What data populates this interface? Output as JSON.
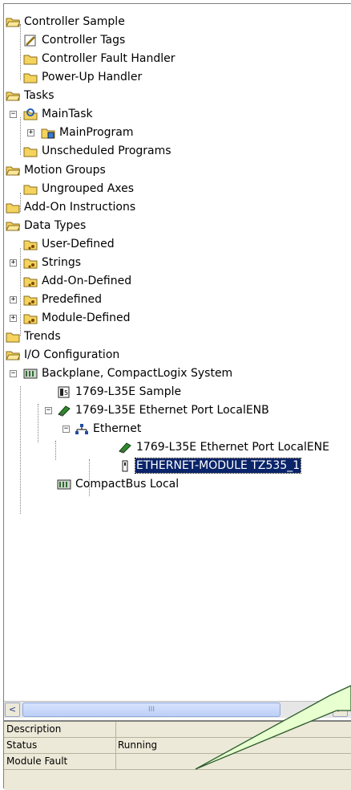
{
  "tree": {
    "controller": "Controller Sample",
    "controller_tags": "Controller Tags",
    "controller_fault_handler": "Controller Fault Handler",
    "power_up_handler": "Power-Up Handler",
    "tasks": "Tasks",
    "main_task": "MainTask",
    "main_program": "MainProgram",
    "unscheduled_programs": "Unscheduled Programs",
    "motion_groups": "Motion Groups",
    "ungrouped_axes": "Ungrouped Axes",
    "add_on_instructions": "Add-On Instructions",
    "data_types": "Data Types",
    "user_defined": "User-Defined",
    "strings": "Strings",
    "add_on_defined": "Add-On-Defined",
    "predefined": "Predefined",
    "module_defined": "Module-Defined",
    "trends": "Trends",
    "io_configuration": "I/O Configuration",
    "backplane": "Backplane, CompactLogix System",
    "controller_module": "1769-L35E Sample",
    "ethernet_port": "1769-L35E Ethernet Port LocalENB",
    "ethernet": "Ethernet",
    "ethernet_port_child": "1769-L35E Ethernet Port LocalENE",
    "ethernet_module": "ETHERNET-MODULE TZ535_1",
    "compactbus": "CompactBus Local"
  },
  "expander_symbols": {
    "expanded": "−",
    "collapsed": "+"
  },
  "scroll": {
    "left_arrow": "<",
    "right_arrow": ">",
    "thumb_grip": "III"
  },
  "properties": {
    "rows": [
      {
        "key": "Description",
        "value": ""
      },
      {
        "key": "Status",
        "value": "Running"
      },
      {
        "key": "Module Fault",
        "value": ""
      }
    ]
  },
  "colors": {
    "selection": "#0a246a",
    "folder": "#f4d35e",
    "callout_fill": "#e8ffd0",
    "callout_stroke": "#2a5a2a",
    "module_green": "#2f8a2f"
  },
  "icons": {
    "folder": "folder-icon",
    "open_folder": "open-folder-icon",
    "tag": "tag-icon",
    "task": "task-icon",
    "program": "program-icon",
    "datatype": "datatype-icon",
    "backplane": "backplane-icon",
    "controller": "controller-module-icon",
    "module": "module-icon",
    "network": "network-icon",
    "device": "device-icon"
  }
}
